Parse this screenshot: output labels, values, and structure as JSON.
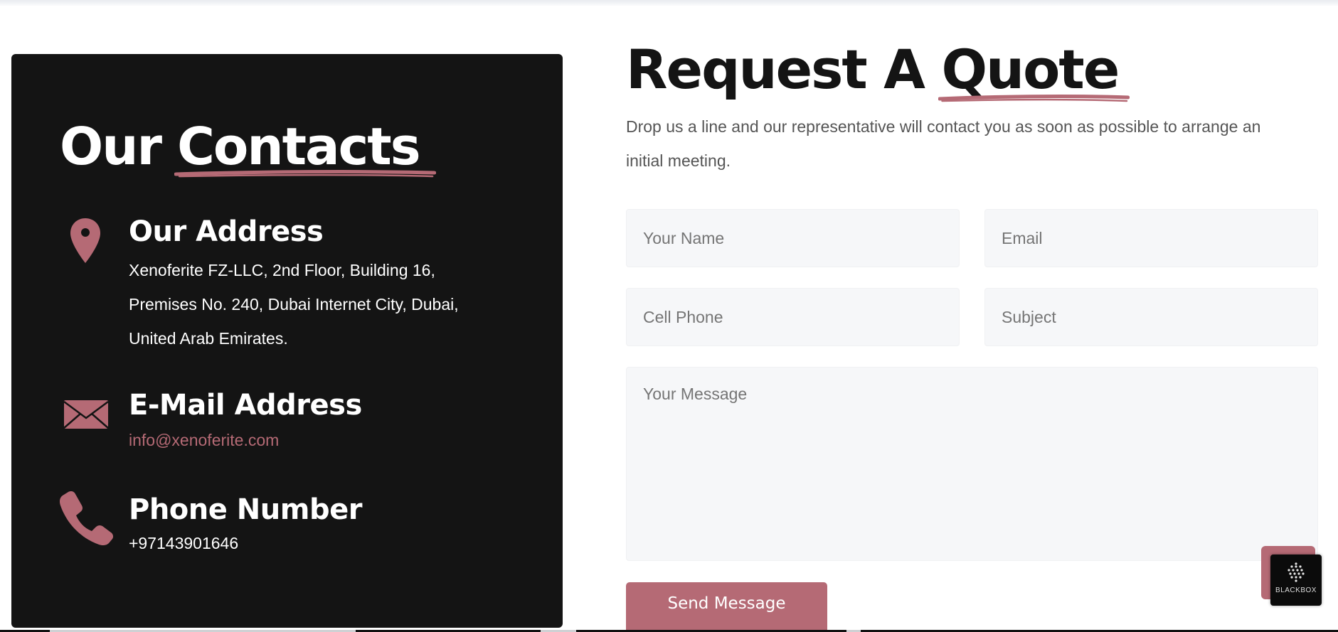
{
  "contacts": {
    "title_plain": "Our",
    "title_accent": "Contacts",
    "address": {
      "icon": "map-pin-icon",
      "title": "Our Address",
      "lines": [
        "Xenoferite FZ-LLC, 2nd Floor, Building 16,",
        "Premises No. 240, Dubai Internet City, Dubai,",
        "United Arab Emirates."
      ]
    },
    "email": {
      "icon": "envelope-icon",
      "title": "E-Mail Address",
      "value": "info@xenoferite.com"
    },
    "phone": {
      "icon": "phone-icon",
      "title": "Phone Number",
      "value": "+97143901646"
    }
  },
  "quote": {
    "title_plain": "Request A",
    "title_accent": "Quote",
    "description": "Drop us a line and our representative will contact you as soon as possible to arrange an initial meeting.",
    "fields": {
      "name_placeholder": "Your Name",
      "email_placeholder": "Email",
      "phone_placeholder": "Cell Phone",
      "subject_placeholder": "Subject",
      "message_placeholder": "Your Message"
    },
    "submit_label": "Send Message"
  },
  "widget": {
    "label": "BLACKBOX",
    "icon": "blackbox-logo-icon"
  },
  "colors": {
    "accent": "#b56a75",
    "card_background": "#141414",
    "field_background": "#f6f7f9"
  }
}
